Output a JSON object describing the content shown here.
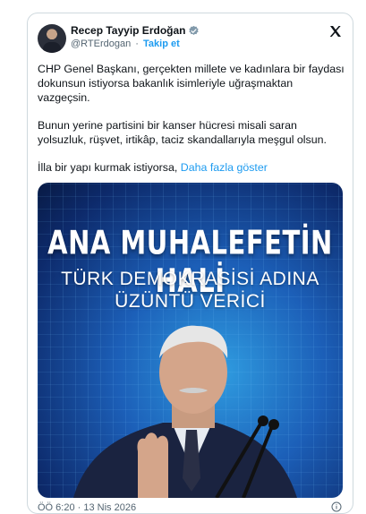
{
  "tweet": {
    "author_name": "Recep Tayyip Erdoğan",
    "handle": "@RTErdogan",
    "separator": "·",
    "follow_label": "Takip et",
    "paragraphs": [
      "CHP Genel Başkanı, gerçekten millete ve kadınlara bir faydası dokunsun istiyorsa bakanlık isimleriyle uğraşmaktan vazgeçsin.",
      "Bunun yerine partisini bir kanser hücresi misali saran yolsuzluk, rüşvet, irtikâp, taciz skandallarıyla meşgul olsun."
    ],
    "last_line": "İlla bir yapı kurmak istiyorsa,",
    "more_label": "Daha fazla göster",
    "timestamp": "ÖÖ 6:20 · 13 Nis 2026"
  },
  "media": {
    "headline": "ANA MUHALEFETİN HALİ",
    "sub_line_1": "TÜRK DEMOKRASİSİ ADINA",
    "sub_line_2": "ÜZÜNTÜ VERİCİ"
  },
  "colors": {
    "accent": "#1d9bf0",
    "text": "#0f1419",
    "muted": "#536471",
    "border": "#cfd9de"
  },
  "icons": {
    "verified": "verified-badge-icon",
    "platform": "x-logo-icon",
    "info": "info-icon"
  }
}
